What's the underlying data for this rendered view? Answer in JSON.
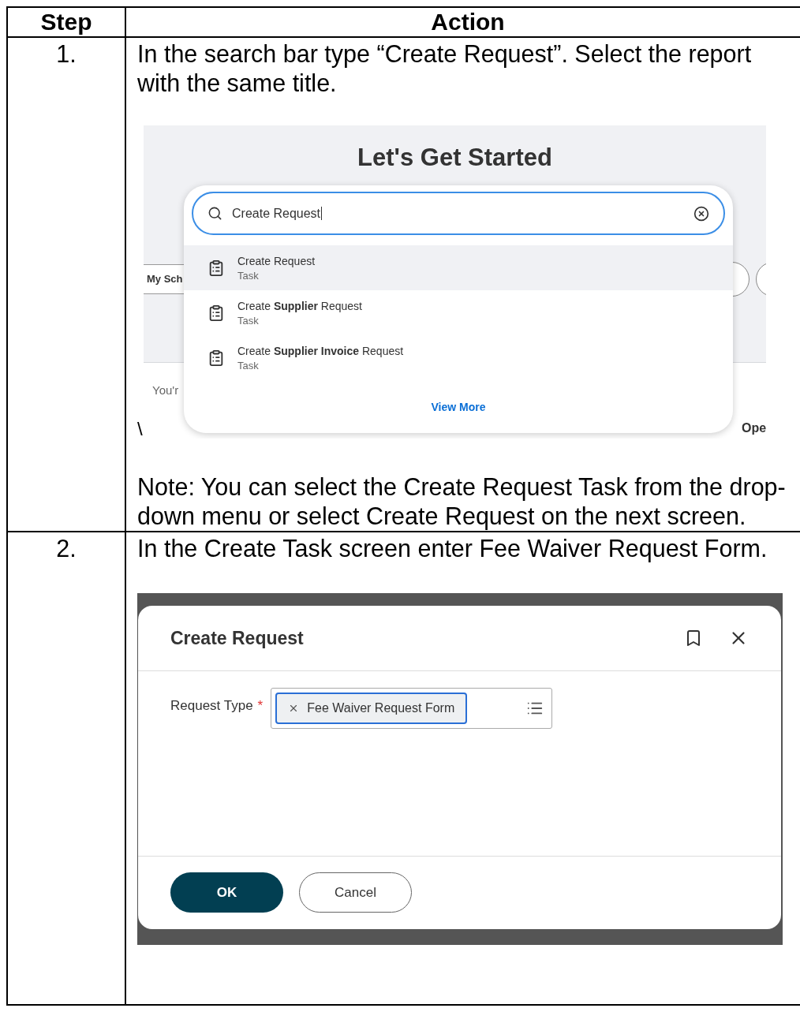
{
  "table": {
    "columns": [
      "Step",
      "Action"
    ],
    "rows": [
      {
        "step": "1.",
        "instruction": "In the search bar type “Create Request”. Select the report with the same title.",
        "stray_mark": "\\",
        "screenshot": {
          "kind": "search",
          "heading": "Let's Get Started",
          "background_tab": "My Sch",
          "background_text": "You'r",
          "background_link": "Ope",
          "search": {
            "value": "Create Request"
          },
          "results": [
            {
              "title": "Create Request",
              "subtitle": "Task",
              "selected": true
            },
            {
              "title": "Create **Supplier** Request",
              "subtitle": "Task",
              "selected": false
            },
            {
              "title": "Create **Supplier Invoice** Request",
              "subtitle": "Task",
              "selected": false
            }
          ],
          "view_more": "View More"
        },
        "note": "Note: You can select the Create Request Task from the drop-down menu or select Create Request on the next screen."
      },
      {
        "step": "2.",
        "instruction": "In the Create Task screen enter Fee Waiver Request Form.",
        "screenshot": {
          "kind": "dialog",
          "title": "Create Request",
          "field": {
            "label": "Request Type",
            "required": true,
            "required_mark": "*",
            "chip": "Fee Waiver Request Form"
          },
          "buttons": [
            {
              "label": "OK",
              "kind": "primary"
            },
            {
              "label": "Cancel",
              "kind": "secondary"
            }
          ]
        }
      }
    ]
  }
}
